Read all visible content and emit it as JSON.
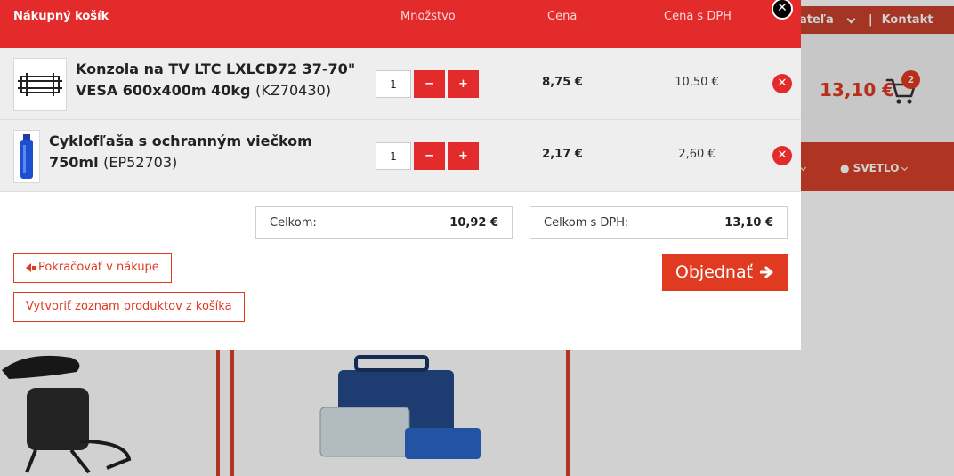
{
  "background": {
    "topbar_links": [
      "ateľa",
      "|",
      "Kontakt"
    ],
    "cart_total": "13,10 €",
    "cart_count": "2",
    "nav_item": "SVETLO"
  },
  "modal": {
    "title": "Nákupný košík",
    "columns": {
      "quantity": "Množstvo",
      "price": "Cena",
      "price_vat": "Cena s DPH"
    },
    "close_icon": "close-icon",
    "items": [
      {
        "name": "Konzola na TV LTC LXLCD72 37-70\" VESA 600x400m 40kg",
        "code": "(KZ70430)",
        "qty": "1",
        "price": "8,75 €",
        "price_vat": "10,50 €",
        "thumb_icon": "tv-mount-icon"
      },
      {
        "name": "Cyklofľaša s ochranným viečkom 750ml",
        "code": "(EP52703)",
        "qty": "1",
        "price": "2,17 €",
        "price_vat": "2,60 €",
        "thumb_icon": "bottle-icon"
      }
    ],
    "qty_minus": "−",
    "qty_plus": "+",
    "totals": {
      "total_label": "Celkom:",
      "total_value": "10,92 €",
      "total_vat_label": "Celkom s DPH:",
      "total_vat_value": "13,10 €"
    },
    "continue_label": "Pokračovať v nákupe",
    "create_list_label": "Vytvoriť zoznam produktov z košíka",
    "order_label": "Objednať"
  },
  "colors": {
    "accent": "#e32b2b",
    "button": "#e03a21"
  }
}
